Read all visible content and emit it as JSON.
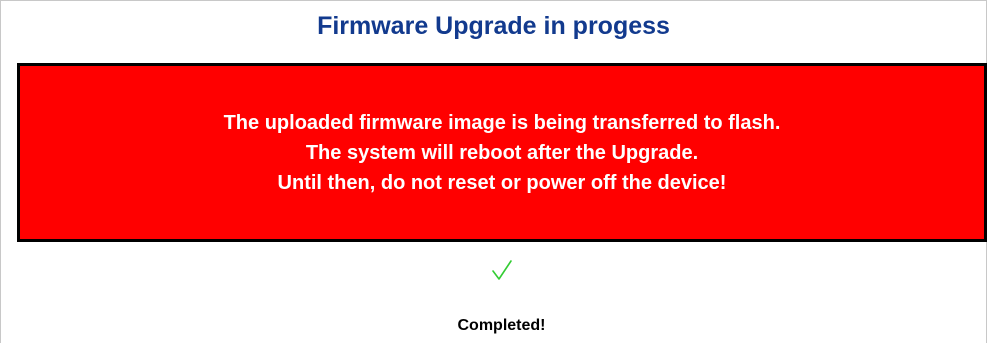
{
  "page": {
    "title": "Firmware Upgrade in progess"
  },
  "warning": {
    "lines": [
      "The uploaded firmware image is being transferred to flash.",
      "The system will reboot after the Upgrade.",
      "Until then, do not reset or power off the device!"
    ],
    "background_color": "#ff0000",
    "border_color": "#000000",
    "text_color": "#ffffff"
  },
  "status": {
    "icon": "checkmark-icon",
    "icon_color": "#33cc33",
    "text": "Completed!"
  },
  "colors": {
    "title": "#123a8e"
  }
}
